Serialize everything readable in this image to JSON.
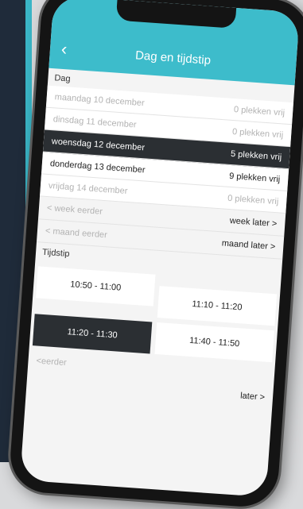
{
  "header": {
    "title": "Dag en tijdstip",
    "back_icon": "chevron-left-icon"
  },
  "day_section": {
    "label": "Dag"
  },
  "days": [
    {
      "day": "maandag 10 december",
      "availability": "0 plekken vrij",
      "state": "disabled"
    },
    {
      "day": "dinsdag 11 december",
      "availability": "0 plekken vrij",
      "state": "disabled"
    },
    {
      "day": "woensdag 12 december",
      "availability": "5 plekken vrij",
      "state": "selected"
    },
    {
      "day": "donderdag 13 december",
      "availability": "9 plekken vrij",
      "state": "enabled"
    },
    {
      "day": "vrijdag 14 december",
      "availability": "0 plekken vrij",
      "state": "disabled"
    }
  ],
  "day_nav": {
    "week_earlier": "< week eerder",
    "week_later": "week later >",
    "month_earlier": "< maand eerder",
    "month_later": "maand later >"
  },
  "time_section": {
    "label": "Tijdstip"
  },
  "slots": [
    {
      "time": "10:50 - 11:00",
      "selected": false
    },
    {
      "time": "11:10 - 11:20",
      "selected": false
    },
    {
      "time": "11:20 - 11:30",
      "selected": true
    },
    {
      "time": "11:40 - 11:50",
      "selected": false
    }
  ],
  "time_nav": {
    "earlier": "<eerder",
    "later": "later >"
  },
  "colors": {
    "accent": "#3dbccb",
    "selected": "#2b2f33"
  }
}
